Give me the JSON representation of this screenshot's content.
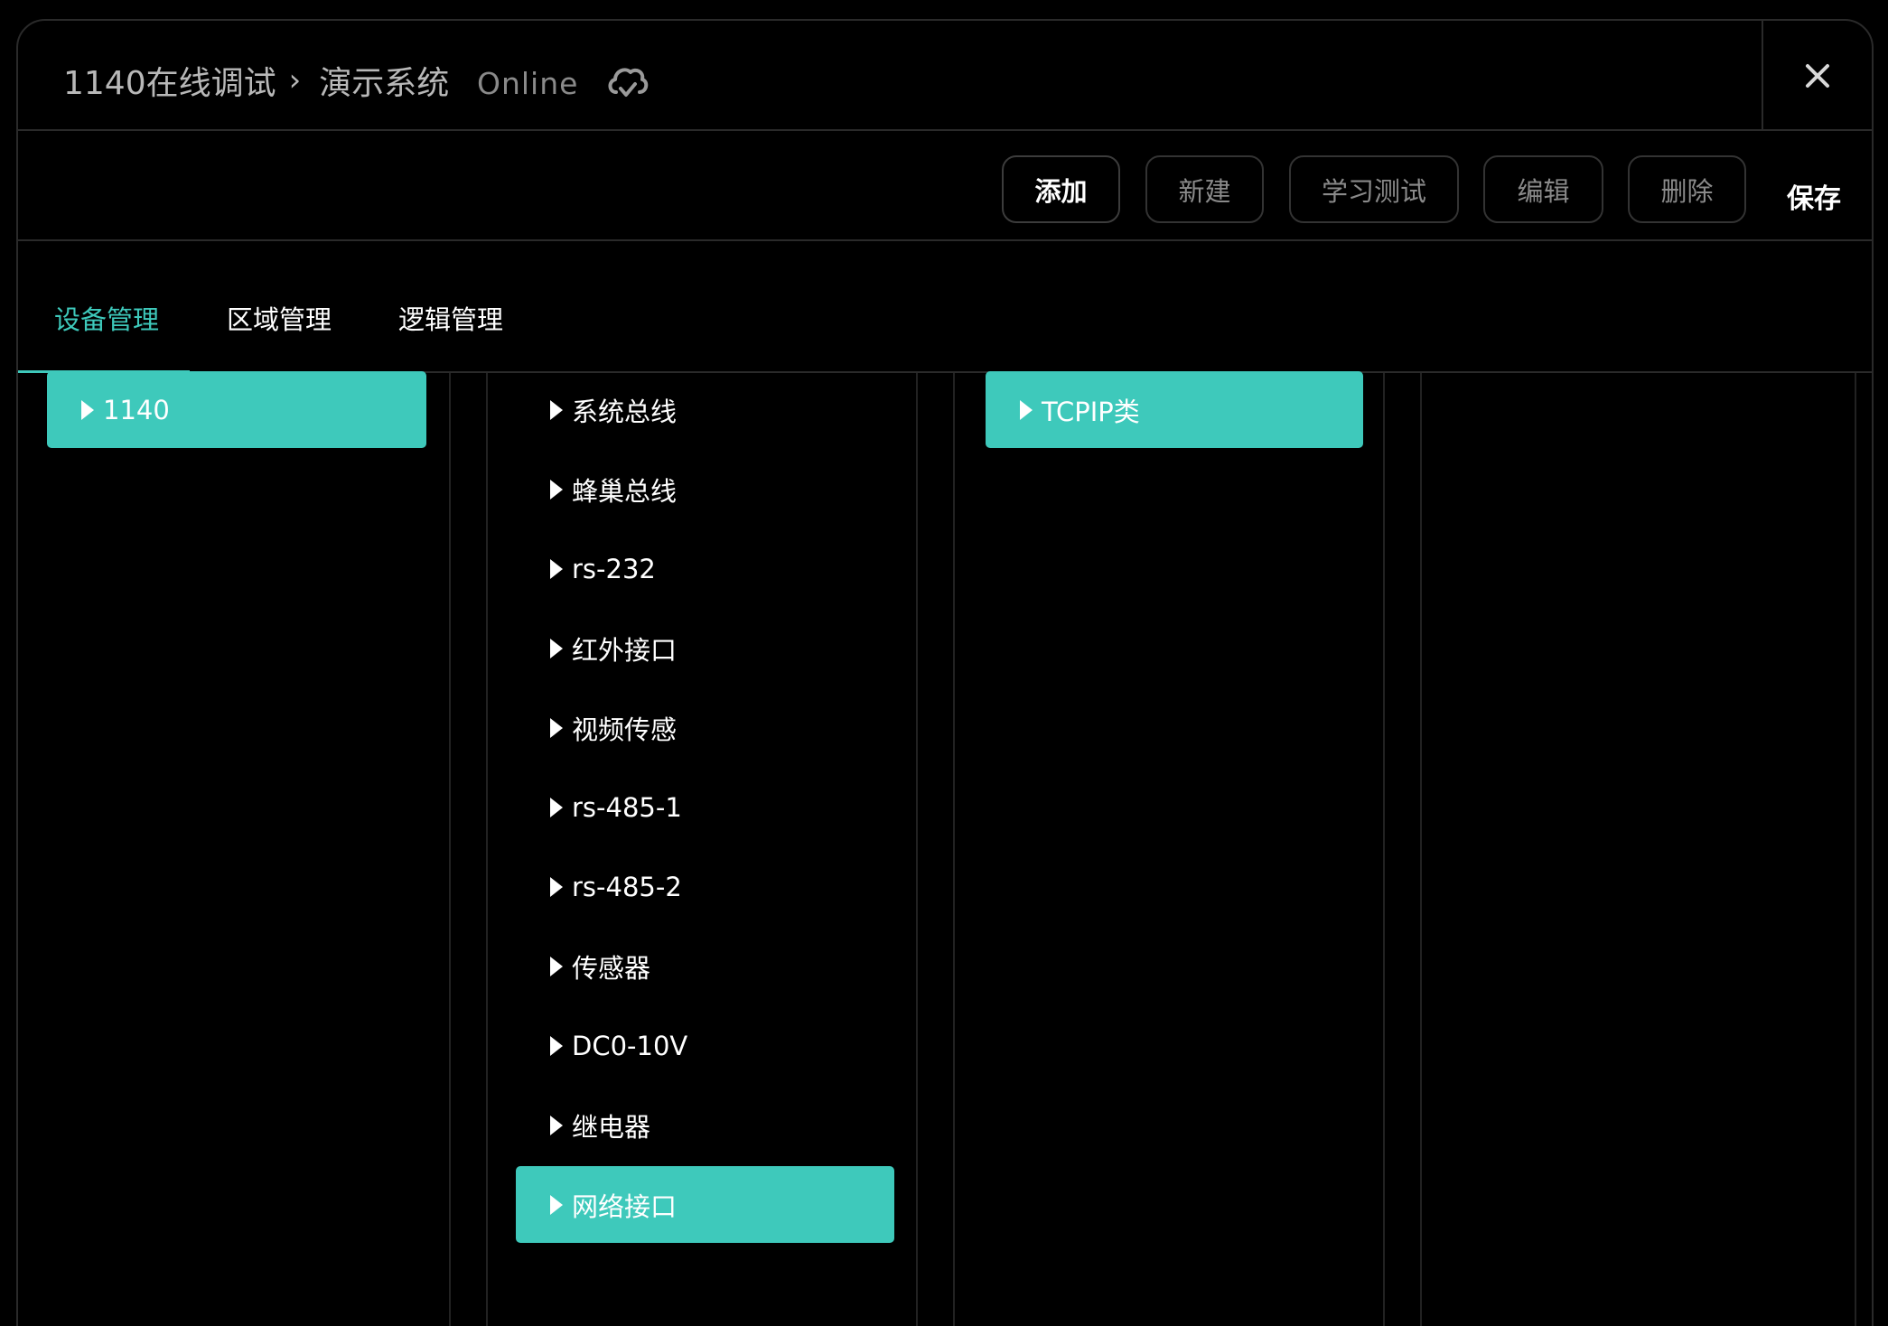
{
  "title": {
    "crumb_root": "1140在线调试",
    "crumb_current": "演示系统",
    "status": "Online",
    "status_icon": "cloud-check-icon",
    "close_icon": "close-icon"
  },
  "toolbar": {
    "add": "添加",
    "new": "新建",
    "learn_test": "学习测试",
    "edit": "编辑",
    "delete": "删除",
    "save": "保存"
  },
  "tabs": [
    {
      "label": "设备管理",
      "active": true
    },
    {
      "label": "区域管理",
      "active": false
    },
    {
      "label": "逻辑管理",
      "active": false
    }
  ],
  "columns": {
    "col1": [
      {
        "label": "1140",
        "selected": true
      }
    ],
    "col2": [
      {
        "label": "系统总线",
        "selected": false
      },
      {
        "label": "蜂巢总线",
        "selected": false
      },
      {
        "label": "rs-232",
        "selected": false
      },
      {
        "label": "红外接口",
        "selected": false
      },
      {
        "label": "视频传感",
        "selected": false
      },
      {
        "label": "rs-485-1",
        "selected": false
      },
      {
        "label": "rs-485-2",
        "selected": false
      },
      {
        "label": "传感器",
        "selected": false
      },
      {
        "label": "DC0-10V",
        "selected": false
      },
      {
        "label": "继电器",
        "selected": false
      },
      {
        "label": "网络接口",
        "selected": true
      }
    ],
    "col3": [
      {
        "label": "TCPIP类",
        "selected": true
      }
    ],
    "col4": []
  },
  "colors": {
    "accent": "#3ec9bb",
    "background": "#000000",
    "border": "#2a2a2a"
  }
}
